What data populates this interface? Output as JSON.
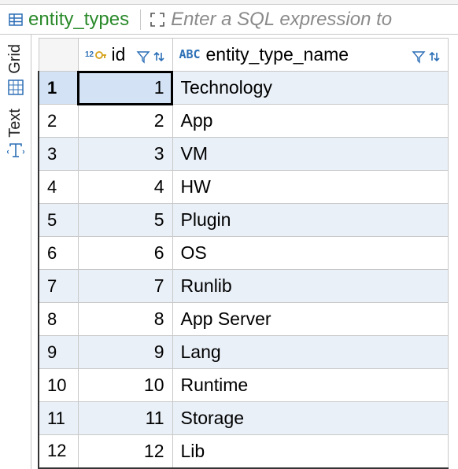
{
  "tab": {
    "table_name": "entity_types",
    "sql_placeholder": "Enter a SQL expression to"
  },
  "sidebar": {
    "tabs": [
      {
        "label": "Grid",
        "icon": "grid-icon"
      },
      {
        "label": "Text",
        "icon": "text-icon"
      }
    ]
  },
  "columns": [
    {
      "name": "id",
      "type": "int"
    },
    {
      "name": "entity_type_name",
      "type": "string"
    }
  ],
  "rows": [
    {
      "n": "1",
      "id": "1",
      "name": "Technology",
      "selected": true,
      "focus_col": 0
    },
    {
      "n": "2",
      "id": "2",
      "name": "App"
    },
    {
      "n": "3",
      "id": "3",
      "name": "VM"
    },
    {
      "n": "4",
      "id": "4",
      "name": "HW"
    },
    {
      "n": "5",
      "id": "5",
      "name": "Plugin"
    },
    {
      "n": "6",
      "id": "6",
      "name": "OS"
    },
    {
      "n": "7",
      "id": "7",
      "name": "Runlib"
    },
    {
      "n": "8",
      "id": "8",
      "name": "App Server"
    },
    {
      "n": "9",
      "id": "9",
      "name": "Lang"
    },
    {
      "n": "10",
      "id": "10",
      "name": "Runtime"
    },
    {
      "n": "11",
      "id": "11",
      "name": "Storage"
    },
    {
      "n": "12",
      "id": "12",
      "name": "Lib"
    }
  ]
}
